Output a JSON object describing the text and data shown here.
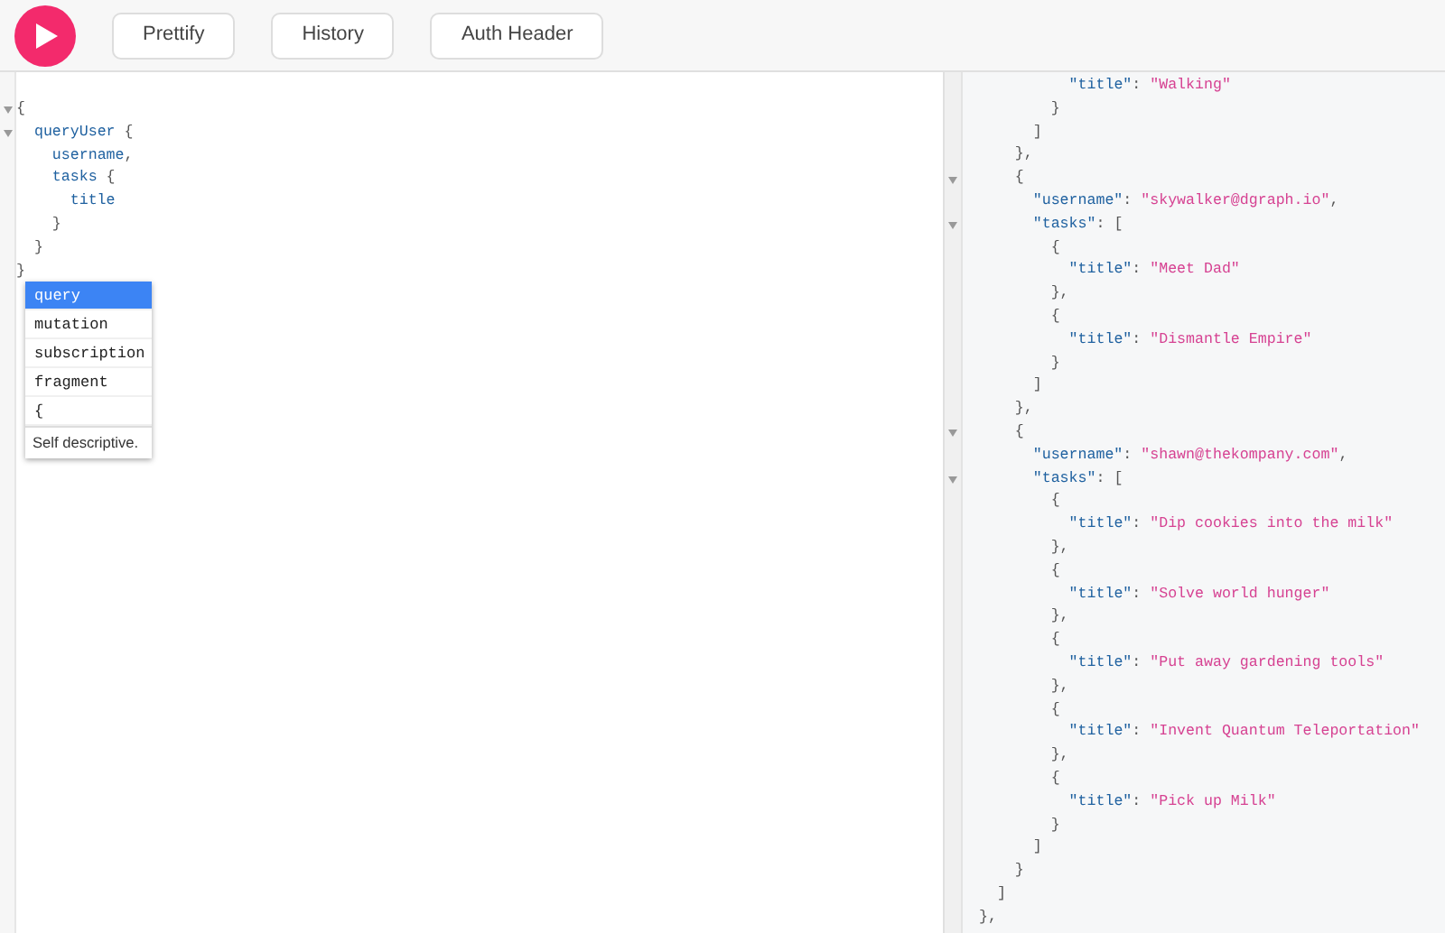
{
  "toolbar": {
    "buttons": [
      "Prettify",
      "History",
      "Auth Header"
    ]
  },
  "query_editor": {
    "lines": [
      {
        "fold": true,
        "code": "{"
      },
      {
        "fold": true,
        "code": "  queryUser {"
      },
      {
        "fold": false,
        "code": "    username,"
      },
      {
        "fold": false,
        "code": "    tasks {"
      },
      {
        "fold": false,
        "code": "      title"
      },
      {
        "fold": false,
        "code": "    }"
      },
      {
        "fold": false,
        "code": "  }"
      },
      {
        "fold": false,
        "code": "}"
      }
    ],
    "autocomplete": {
      "items": [
        {
          "label": "query",
          "selected": true
        },
        {
          "label": "mutation",
          "selected": false
        },
        {
          "label": "subscription",
          "selected": false
        },
        {
          "label": "fragment",
          "selected": false
        },
        {
          "label": "{",
          "selected": false
        }
      ],
      "description": "Self descriptive."
    }
  },
  "result": {
    "lines": [
      {
        "fold": false,
        "code": "          \"title\": \"Walking\""
      },
      {
        "fold": false,
        "code": "        }"
      },
      {
        "fold": false,
        "code": "      ]"
      },
      {
        "fold": false,
        "code": "    },"
      },
      {
        "fold": true,
        "code": "    {"
      },
      {
        "fold": false,
        "code": "      \"username\": \"skywalker@dgraph.io\","
      },
      {
        "fold": true,
        "code": "      \"tasks\": ["
      },
      {
        "fold": false,
        "code": "        {"
      },
      {
        "fold": false,
        "code": "          \"title\": \"Meet Dad\""
      },
      {
        "fold": false,
        "code": "        },"
      },
      {
        "fold": false,
        "code": "        {"
      },
      {
        "fold": false,
        "code": "          \"title\": \"Dismantle Empire\""
      },
      {
        "fold": false,
        "code": "        }"
      },
      {
        "fold": false,
        "code": "      ]"
      },
      {
        "fold": false,
        "code": "    },"
      },
      {
        "fold": true,
        "code": "    {"
      },
      {
        "fold": false,
        "code": "      \"username\": \"shawn@thekompany.com\","
      },
      {
        "fold": true,
        "code": "      \"tasks\": ["
      },
      {
        "fold": false,
        "code": "        {"
      },
      {
        "fold": false,
        "code": "          \"title\": \"Dip cookies into the milk\""
      },
      {
        "fold": false,
        "code": "        },"
      },
      {
        "fold": false,
        "code": "        {"
      },
      {
        "fold": false,
        "code": "          \"title\": \"Solve world hunger\""
      },
      {
        "fold": false,
        "code": "        },"
      },
      {
        "fold": false,
        "code": "        {"
      },
      {
        "fold": false,
        "code": "          \"title\": \"Put away gardening tools\""
      },
      {
        "fold": false,
        "code": "        },"
      },
      {
        "fold": false,
        "code": "        {"
      },
      {
        "fold": false,
        "code": "          \"title\": \"Invent Quantum Teleportation\""
      },
      {
        "fold": false,
        "code": "        },"
      },
      {
        "fold": false,
        "code": "        {"
      },
      {
        "fold": false,
        "code": "          \"title\": \"Pick up Milk\""
      },
      {
        "fold": false,
        "code": "        }"
      },
      {
        "fold": false,
        "code": "      ]"
      },
      {
        "fold": false,
        "code": "    }"
      },
      {
        "fold": false,
        "code": "  ]"
      },
      {
        "fold": false,
        "code": "},"
      }
    ]
  }
}
